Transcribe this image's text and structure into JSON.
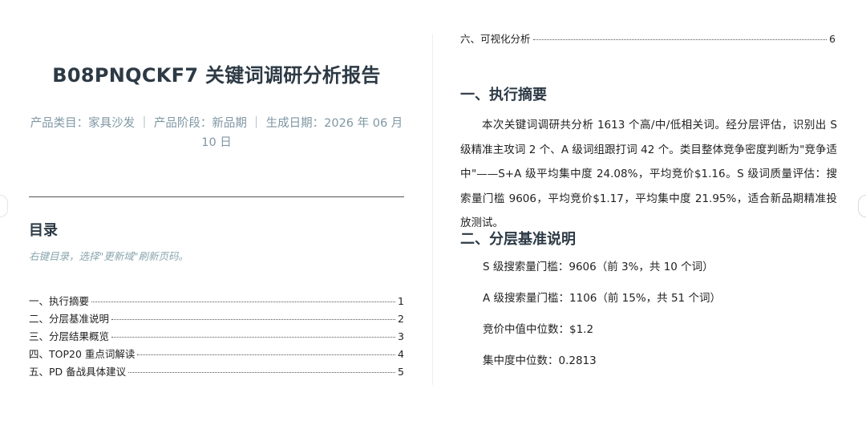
{
  "report": {
    "title": "B08PNQCKF7 关键词调研分析报告",
    "meta": "产品类目：家具沙发 ｜ 产品阶段：新品期 ｜ 生成日期：2026 年 06 月 10 日"
  },
  "toc": {
    "heading": "目录",
    "hint": "右键目录，选择\"更新域\"刷新页码。",
    "items": [
      {
        "label": "一、执行摘要",
        "page": "1"
      },
      {
        "label": "二、分层基准说明",
        "page": "2"
      },
      {
        "label": "三、分层结果概览",
        "page": "3"
      },
      {
        "label": "四、TOP20 重点词解读",
        "page": "4"
      },
      {
        "label": "五、PD 备战具体建议",
        "page": "5"
      },
      {
        "label": "六、可视化分析",
        "page": "6"
      }
    ]
  },
  "sections": {
    "summary": {
      "heading": "一、执行摘要",
      "body": "本次关键词调研共分析 1613 个高/中/低相关词。经分层评估，识别出 S 级精准主攻词 2 个、A 级词组跟打词 42 个。类目整体竞争密度判断为\"竞争适中\"——S+A 级平均集中度 24.08%，平均竞价$1.16。S 级词质量评估：搜索量门槛 9606，平均竞价$1.17，平均集中度 21.95%，适合新品期精准投放测试。"
    },
    "tiering": {
      "heading": "二、分层基准说明",
      "lines": [
        "S 级搜索量门槛：9606（前 3%，共 10 个词）",
        "A 级搜索量门槛：1106（前 15%，共 51 个词）",
        "竞价中值中位数：$1.2",
        "集中度中位数：0.2813"
      ]
    }
  }
}
